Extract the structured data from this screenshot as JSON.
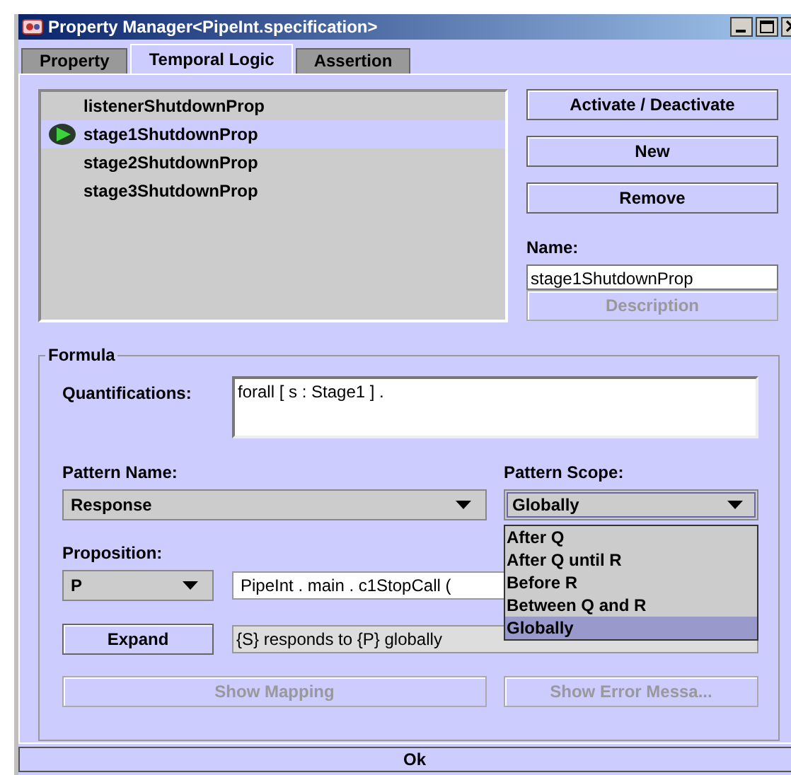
{
  "window": {
    "title": "Property Manager<PipeInt.specification>"
  },
  "tabs": [
    {
      "label": "Property",
      "selected": false
    },
    {
      "label": "Temporal Logic",
      "selected": true
    },
    {
      "label": "Assertion",
      "selected": false
    }
  ],
  "properties": [
    {
      "name": "listenerShutdownProp",
      "selected": false,
      "active": false
    },
    {
      "name": "stage1ShutdownProp",
      "selected": true,
      "active": true
    },
    {
      "name": "stage2ShutdownProp",
      "selected": false,
      "active": false
    },
    {
      "name": "stage3ShutdownProp",
      "selected": false,
      "active": false
    }
  ],
  "buttons": [
    {
      "label": "Activate / Deactivate",
      "disabled": false
    },
    {
      "label": "New",
      "disabled": false
    },
    {
      "label": "Remove",
      "disabled": false
    }
  ],
  "name_field": {
    "label": "Name:",
    "value": "stage1ShutdownProp"
  },
  "description_button": {
    "label": "Description",
    "disabled": true
  },
  "formula": {
    "title": "Formula",
    "quantifications": {
      "label": "Quantifications:",
      "value": "forall [ s : Stage1 ] ."
    },
    "pattern_name": {
      "label": "Pattern Name:",
      "value": "Response"
    },
    "pattern_scope": {
      "label": "Pattern Scope:",
      "value": "Globally",
      "expanded": true,
      "options": [
        {
          "label": "After Q",
          "selected": false
        },
        {
          "label": "After Q until R",
          "selected": false
        },
        {
          "label": "Before R",
          "selected": false
        },
        {
          "label": "Between Q and R",
          "selected": false
        },
        {
          "label": "Globally",
          "selected": true
        }
      ]
    },
    "proposition": {
      "label": "Proposition:",
      "value": "P",
      "expression": "PipeInt . main . c1StopCall ("
    },
    "expand_button": {
      "label": "Expand",
      "disabled": false
    },
    "expansion": "{S} responds to {P} globally",
    "show_mapping": {
      "label": "Show Mapping",
      "disabled": true
    },
    "show_error": {
      "label": "Show Error Messa...",
      "disabled": true
    }
  },
  "ok_button": {
    "label": "Ok"
  }
}
